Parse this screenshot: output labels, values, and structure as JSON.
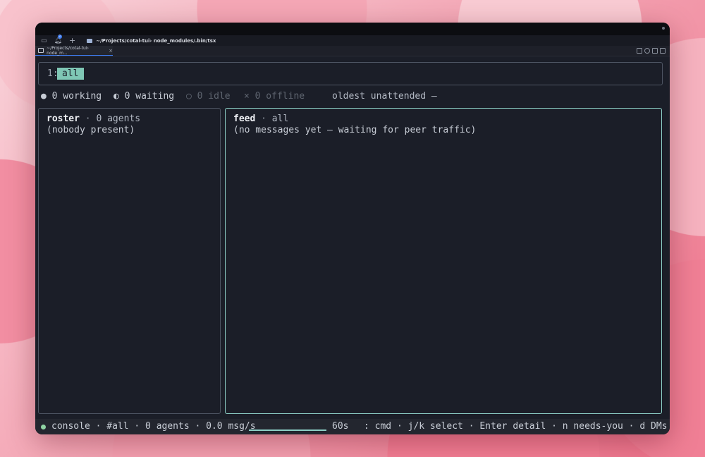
{
  "window": {
    "path_title": "~/Projects/cotal-tui› node_modules/.bin/tsx",
    "notification_count": "3",
    "tab_label": "~/Projects/cotal-tui› node_m...",
    "tab_close": "×"
  },
  "tabline": {
    "index": "1:",
    "active_tab": "all"
  },
  "status": {
    "working": "● 0 working",
    "waiting": "◐ 0 waiting",
    "idle": "○ 0 idle",
    "offline": "× 0 offline",
    "oldest": "oldest unattended —"
  },
  "roster": {
    "title": "roster",
    "sep": "·",
    "subtitle": "0 agents",
    "empty": "(nobody present)"
  },
  "feed": {
    "title": "feed",
    "sep": "·",
    "subtitle": "all",
    "empty": "(no messages yet — waiting for peer traffic)"
  },
  "bottom": {
    "summary": "console · #all · 0 agents · 0.0 msg/s",
    "seconds": "60s",
    "hints": ": cmd · j/k select · Enter detail · n needs-you · d DMs …"
  },
  "colors": {
    "accent": "#7fc7b5",
    "working_green": "#8fd3a3",
    "feed_border": "#8ccfc6"
  },
  "icons": [
    "sidebar-toggle-icon",
    "bell-icon",
    "plus-icon",
    "folder-icon",
    "terminal-icon",
    "layout-icon",
    "globe-icon",
    "split-icon"
  ]
}
